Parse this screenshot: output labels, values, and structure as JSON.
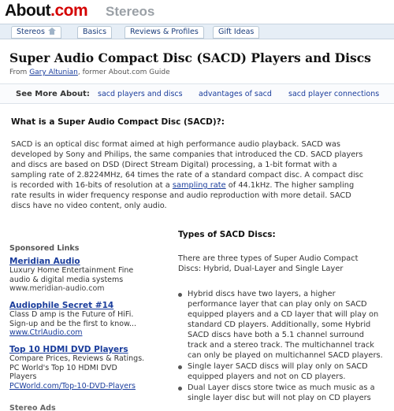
{
  "header": {
    "logo_text": "About",
    "logo_suffix": ".com",
    "site_name": "Stereos"
  },
  "nav": {
    "tabs": [
      {
        "label": "Stereos",
        "icon": "home-icon"
      },
      {
        "label": "Basics"
      },
      {
        "label": "Reviews & Profiles"
      },
      {
        "label": "Gift Ideas"
      }
    ]
  },
  "article": {
    "title": "Super Audio Compact Disc (SACD) Players and Discs",
    "byline_prefix": "From",
    "author": "Gary Altunian",
    "byline_suffix": ", former About.com Guide",
    "heading": "What is a Super Audio Compact Disc (SACD)?:",
    "intro_lines": [
      "SACD is an optical disc format aimed at high performance audio playback. SACD was",
      "developed by Sony and Philips, the same companies that introduced the CD. SACD players",
      "and discs are based on DSD (Direct Stream Digital) processing, a 1-bit format with a",
      "sampling rate of 2.8224MHz, 64 times the rate of a standard compact disc. A compact disc"
    ],
    "intro_line5_before": "is recorded with 16-bits of resolution at a ",
    "intro_line5_link": "sampling rate",
    "intro_line5_after": " of 44.1kHz. The higher sampling",
    "intro_lines_end": [
      "rate results in wider frequency response and audio reproduction with more detail. SACD",
      "discs have no video content, only audio."
    ]
  },
  "see_more": {
    "label": "See More About:",
    "links": [
      "sacd players and discs",
      "advantages of sacd",
      "sacd player connections"
    ]
  },
  "sponsored": {
    "title": "Sponsored Links",
    "ads": [
      {
        "title": "Meridian Audio",
        "desc": [
          "Luxury Home Entertainment Fine",
          "audio & digital media systems"
        ],
        "url": "www.meridian-audio.com"
      },
      {
        "title": "Audiophile Secret #14",
        "desc": [
          "Class D amp is the Future of HiFi.",
          "Sign-up and be the first to know..."
        ],
        "url": "www.CtrlAudio.com"
      },
      {
        "title": "Top 10 HDMI DVD Players",
        "desc": [
          "Compare Prices, Reviews & Ratings.",
          "PC World's Top 10 HDMI DVD",
          "Players"
        ],
        "url": "PCWorld.com/Top-10-DVD-Players"
      }
    ],
    "more_label": "Stereo Ads"
  },
  "types": {
    "heading": "Types of SACD Discs:",
    "intro_lines": [
      "There are three types of Super Audio Compact",
      "Discs: Hybrid, Dual-Layer and Single Layer"
    ],
    "items": [
      [
        "Hybrid discs have two layers, a higher",
        "performance layer that can play only on SACD",
        "equipped players and a CD layer that will play on",
        "standard CD players. Additionally, some Hybrid",
        "SACD discs have both a 5.1 channel surround",
        "track and a stereo track. The multichannel track",
        "can only be played on multichannel SACD players."
      ],
      [
        "Single layer SACD discs will play only on SACD",
        "equipped players and not on CD players."
      ],
      [
        "Dual Layer discs store twice as much music as a",
        "single layer disc but will not play on CD players"
      ]
    ]
  }
}
